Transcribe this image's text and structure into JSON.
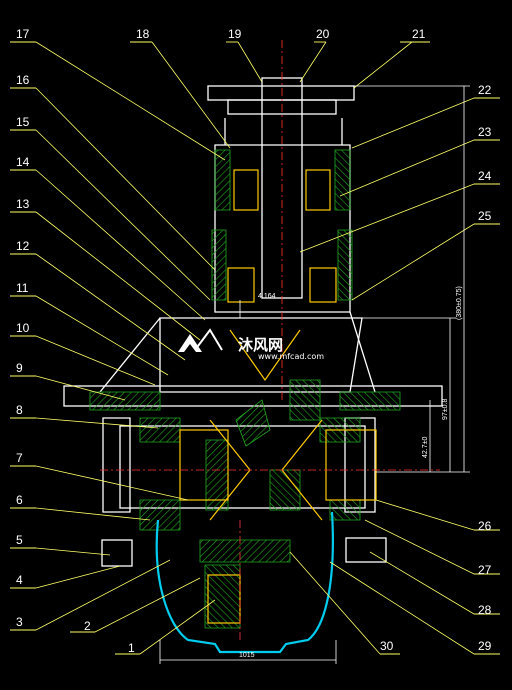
{
  "drawing": {
    "part_labels": [
      "1",
      "2",
      "3",
      "4",
      "5",
      "6",
      "7",
      "8",
      "9",
      "10",
      "11",
      "12",
      "13",
      "14",
      "15",
      "16",
      "17",
      "18",
      "19",
      "20",
      "21",
      "22",
      "23",
      "24",
      "25",
      "26",
      "27",
      "28",
      "29",
      "30"
    ],
    "dimensions": {
      "bottom_width": "1015",
      "vertical_overall": "(380±0.75)",
      "vertical_mid": "97±0.8",
      "vertical_lower": "42.7±0",
      "upper_small": "4.164"
    },
    "watermark": {
      "text": "沐风网",
      "url": "www.mfcad.com"
    },
    "colors": {
      "background": "#000000",
      "outline": "#ffffff",
      "leader": "#ffff66",
      "hatch": "#22aa22",
      "centerline": "#ff3333",
      "bearing": "#ffcc00",
      "housing_cover": "#00ccee",
      "dimension": "#ffffff"
    }
  }
}
